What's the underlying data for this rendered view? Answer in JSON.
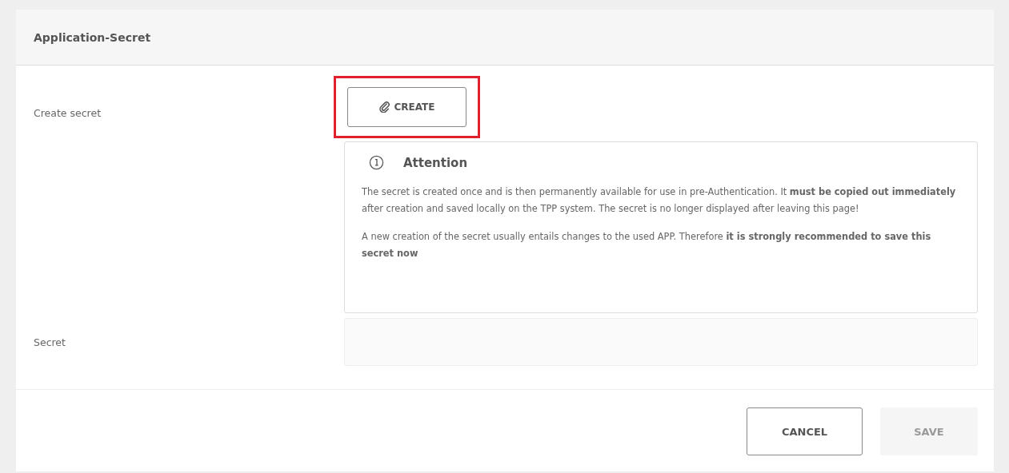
{
  "panel": {
    "title": "Application-Secret"
  },
  "create_row": {
    "label": "Create secret",
    "button": {
      "label": "CREATE",
      "highlighted": true
    }
  },
  "notice": {
    "title": "Attention",
    "paragraphs": [
      "The secret is created once and is then permanently available for use in pre-Authentication. It **must be copied out immediately** after creation and saved locally on the TPP system. The secret is no longer displayed after leaving this page!",
      "A new creation of the secret usually entails changes to the used APP. Therefore **it is strongly recommended to save this secret now**"
    ]
  },
  "secret_row": {
    "label": "Secret"
  },
  "buttons": [
    {
      "label": "CANCEL",
      "disabled": false
    },
    {
      "label": "SAVE",
      "disabled": true
    }
  ]
}
